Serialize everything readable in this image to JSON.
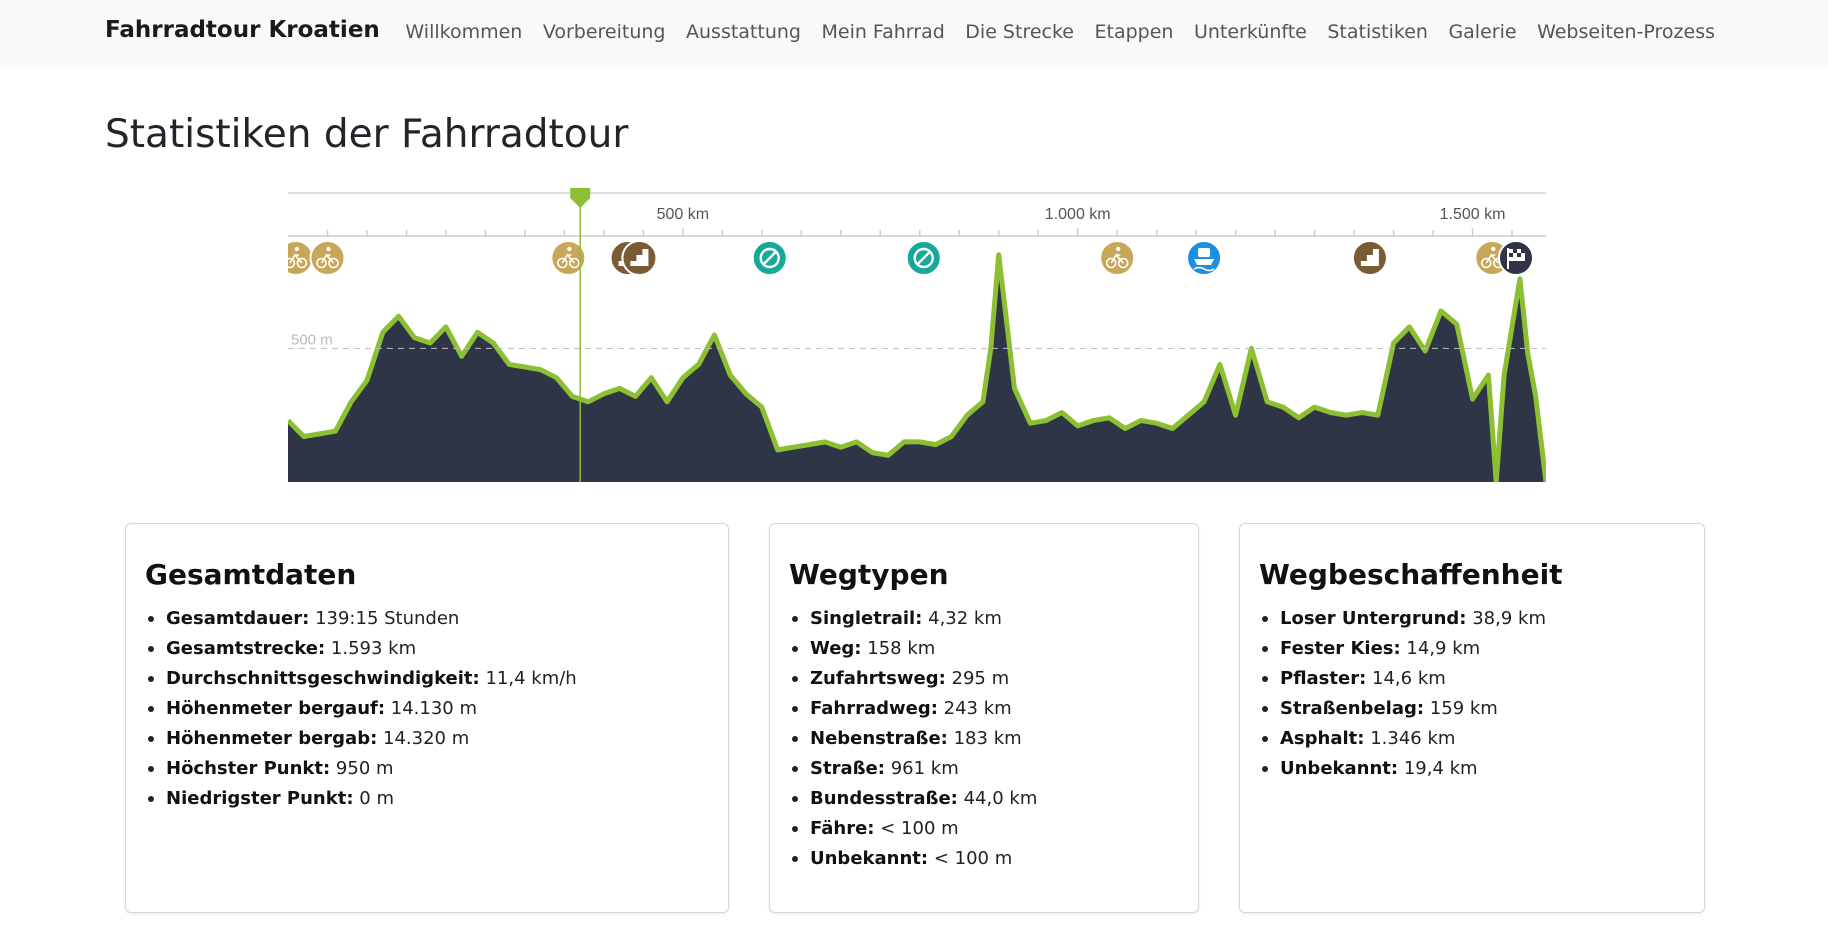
{
  "header": {
    "brand": "Fahrradtour Kroatien",
    "nav": [
      "Willkommen",
      "Vorbereitung",
      "Ausstattung",
      "Mein Fahrrad",
      "Die Strecke",
      "Etappen",
      "Unterkünfte",
      "Statistiken",
      "Galerie",
      "Webseiten-Prozess"
    ]
  },
  "page": {
    "title": "Statistiken der Fahrradtour"
  },
  "profile": {
    "distance_labels": [
      "500 km",
      "1.000 km",
      "1.500 km"
    ],
    "elevation_label": "500 m",
    "colors": {
      "area": "#2e3546",
      "line": "#8dbf32",
      "marker": "#8dbf32"
    },
    "chart_data": {
      "type": "area",
      "xlabel": "",
      "ylabel": "",
      "x_unit": "km",
      "y_unit": "m",
      "xlim": [
        0,
        1593
      ],
      "ylim": [
        0,
        950
      ],
      "xticks": [
        500,
        1000,
        1500
      ],
      "yticks": [
        500
      ],
      "cursor_x": 370,
      "grid": false,
      "x": [
        0,
        20,
        40,
        60,
        80,
        100,
        120,
        140,
        160,
        180,
        200,
        220,
        240,
        260,
        280,
        300,
        320,
        340,
        360,
        380,
        400,
        420,
        440,
        460,
        480,
        500,
        520,
        540,
        560,
        580,
        600,
        620,
        640,
        660,
        680,
        700,
        720,
        740,
        760,
        780,
        800,
        820,
        840,
        860,
        880,
        890,
        900,
        910,
        920,
        940,
        960,
        980,
        1000,
        1020,
        1040,
        1060,
        1080,
        1100,
        1120,
        1140,
        1160,
        1180,
        1200,
        1220,
        1240,
        1260,
        1280,
        1300,
        1320,
        1340,
        1360,
        1380,
        1400,
        1420,
        1440,
        1460,
        1480,
        1500,
        1520,
        1530,
        1540,
        1550,
        1560,
        1570,
        1580,
        1593
      ],
      "y": [
        230,
        170,
        180,
        190,
        300,
        380,
        560,
        620,
        540,
        520,
        580,
        470,
        560,
        520,
        440,
        430,
        420,
        390,
        320,
        300,
        330,
        350,
        320,
        390,
        300,
        390,
        440,
        550,
        400,
        330,
        280,
        120,
        130,
        140,
        150,
        130,
        150,
        110,
        100,
        150,
        150,
        140,
        170,
        250,
        300,
        500,
        850,
        600,
        350,
        220,
        230,
        260,
        210,
        230,
        240,
        200,
        230,
        220,
        200,
        250,
        300,
        440,
        250,
        500,
        300,
        280,
        240,
        280,
        260,
        250,
        260,
        250,
        520,
        580,
        490,
        640,
        590,
        310,
        400,
        0,
        400,
        580,
        760,
        480,
        320,
        0
      ]
    },
    "poi_icons": [
      "bicycle-icon",
      "bicycle-icon",
      "bicycle-icon",
      "stairs-icon",
      "stairs-icon",
      "no-entry-icon",
      "no-entry-icon",
      "bicycle-icon",
      "ferry-icon",
      "stairs-icon",
      "bicycle-icon",
      "finish-flag-icon"
    ],
    "poi_km": [
      10,
      50,
      355,
      430,
      445,
      610,
      805,
      1050,
      1160,
      1370,
      1525,
      1555
    ],
    "poi_colors": [
      "#c8a75a",
      "#c8a75a",
      "#c8a75a",
      "#7a5c34",
      "#7a5c34",
      "#14a99a",
      "#14a99a",
      "#c8a75a",
      "#1c8fe0",
      "#7a5c34",
      "#c8a75a",
      "#2e3546"
    ]
  },
  "cards": [
    {
      "title": "Gesamtdaten",
      "items": [
        {
          "label": "Gesamtdauer:",
          "value": "139:15 Stunden"
        },
        {
          "label": "Gesamtstrecke:",
          "value": "1.593 km"
        },
        {
          "label": "Durchschnittsgeschwindigkeit:",
          "value": "11,4 km/h"
        },
        {
          "label": "Höhenmeter bergauf:",
          "value": "14.130 m"
        },
        {
          "label": "Höhenmeter bergab:",
          "value": "14.320 m"
        },
        {
          "label": "Höchster Punkt:",
          "value": "950 m"
        },
        {
          "label": "Niedrigster Punkt:",
          "value": "0 m"
        }
      ]
    },
    {
      "title": "Wegtypen",
      "items": [
        {
          "label": "Singletrail:",
          "value": "4,32 km"
        },
        {
          "label": "Weg:",
          "value": "158 km"
        },
        {
          "label": "Zufahrtsweg:",
          "value": "295 m"
        },
        {
          "label": "Fahrradweg:",
          "value": "243 km"
        },
        {
          "label": "Nebenstraße:",
          "value": "183 km"
        },
        {
          "label": "Straße:",
          "value": "961 km"
        },
        {
          "label": "Bundesstraße:",
          "value": "44,0 km"
        },
        {
          "label": "Fähre:",
          "value": "< 100 m"
        },
        {
          "label": "Unbekannt:",
          "value": "< 100 m"
        }
      ]
    },
    {
      "title": "Wegbeschaffenheit",
      "items": [
        {
          "label": "Loser Untergrund:",
          "value": "38,9 km"
        },
        {
          "label": "Fester Kies:",
          "value": "14,9 km"
        },
        {
          "label": "Pflaster:",
          "value": "14,6 km"
        },
        {
          "label": "Straßenbelag:",
          "value": "159 km"
        },
        {
          "label": "Asphalt:",
          "value": "1.346 km"
        },
        {
          "label": "Unbekannt:",
          "value": "19,4 km"
        }
      ]
    }
  ]
}
